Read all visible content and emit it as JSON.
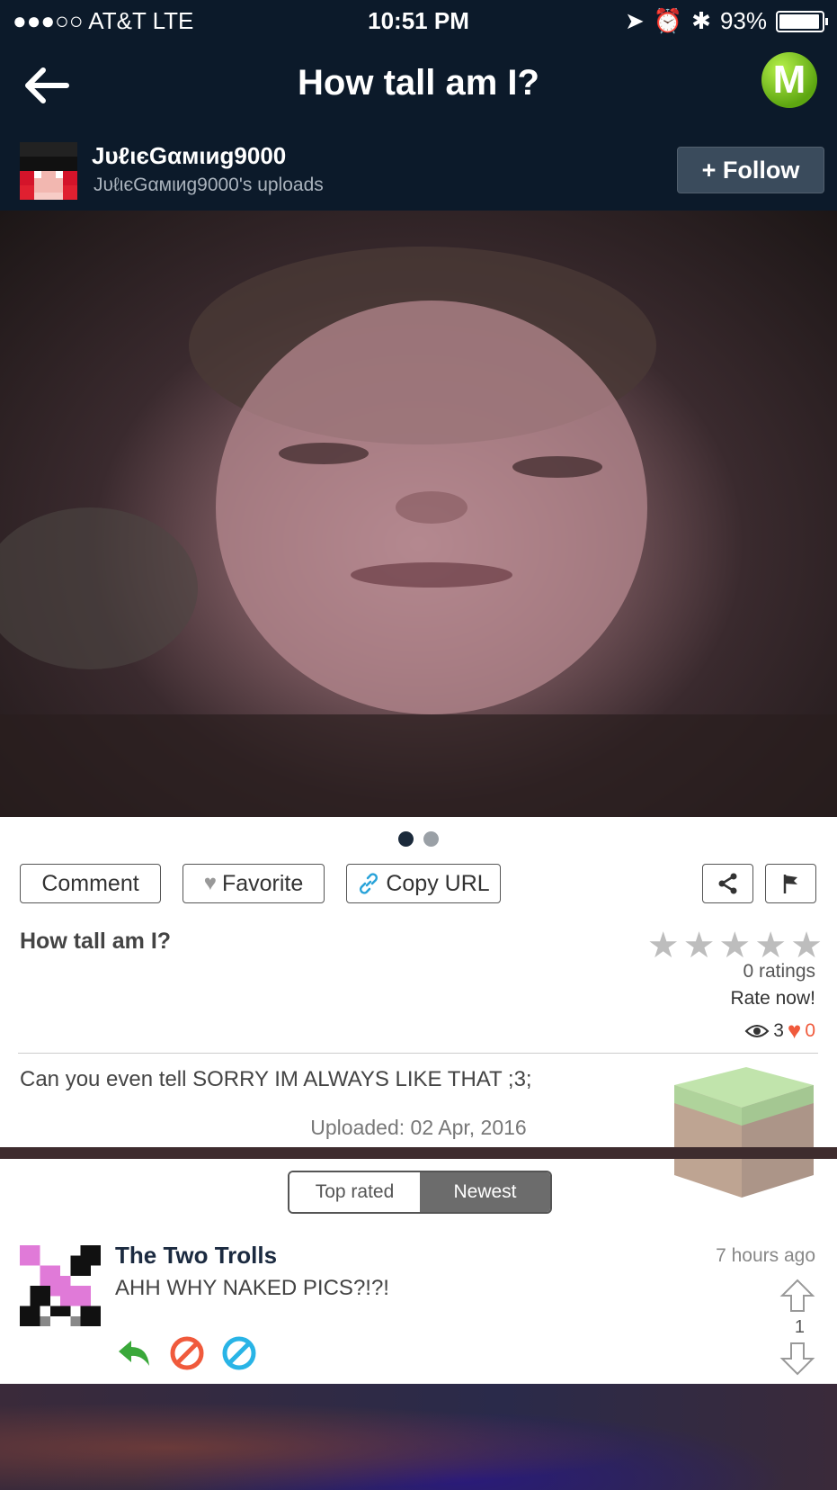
{
  "status_bar": {
    "carrier": "●●●○○ AT&T   LTE",
    "time": "10:51 PM",
    "battery": "93%",
    "battery_level": 0.93
  },
  "nav": {
    "title": "How tall am I?",
    "logo_letter": "M"
  },
  "user": {
    "name": "JυℓιєGαмιиg9000",
    "uploads": "JυℓιєGαмιиg9000's uploads",
    "follow_label": "+ Follow"
  },
  "actions": {
    "comment": "Comment",
    "favorite": "Favorite",
    "copy_url": "Copy URL"
  },
  "post": {
    "title": "How tall am I?",
    "ratings": "0 ratings",
    "rate_now": "Rate now!",
    "views": "3",
    "likes": "0",
    "description": "Can you even tell SORRY IM ALWAYS LIKE THAT ;3;",
    "uploaded": "Uploaded: 02 Apr, 2016"
  },
  "sort_tabs": {
    "top_rated": "Top rated",
    "newest": "Newest",
    "selected": "Newest"
  },
  "comment": {
    "user": "The Two Trolls",
    "text": "AHH WHY NAKED PICS?!?!",
    "time": "7 hours ago",
    "votes": "1"
  },
  "colors": {
    "header_bg": "#0c1a2a",
    "accent_green": "#5da611",
    "heart": "#f05a3c"
  }
}
